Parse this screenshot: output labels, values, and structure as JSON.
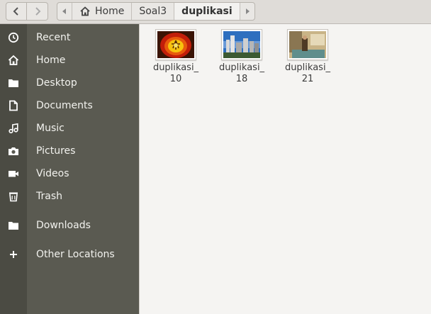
{
  "nav": {
    "back_icon": "chevron-left",
    "forward_icon": "chevron-right"
  },
  "pathbar": {
    "segments": [
      {
        "label": "Home",
        "icon": "home-icon"
      },
      {
        "label": "Soal3"
      },
      {
        "label": "duplikasi",
        "current": true
      }
    ]
  },
  "sidebar": {
    "items": [
      {
        "label": "Recent",
        "icon": "clock-icon"
      },
      {
        "label": "Home",
        "icon": "home-icon"
      },
      {
        "label": "Desktop",
        "icon": "folder-icon"
      },
      {
        "label": "Documents",
        "icon": "document-icon"
      },
      {
        "label": "Music",
        "icon": "music-icon"
      },
      {
        "label": "Pictures",
        "icon": "camera-icon"
      },
      {
        "label": "Videos",
        "icon": "video-icon"
      },
      {
        "label": "Trash",
        "icon": "trash-icon"
      },
      {
        "label": "Downloads",
        "icon": "folder-icon"
      },
      {
        "label": "Other Locations",
        "icon": "plus-icon"
      }
    ]
  },
  "files": [
    {
      "line1": "duplikasi_",
      "line2": "10",
      "thumb": "tulip-image"
    },
    {
      "line1": "duplikasi_",
      "line2": "18",
      "thumb": "city-skyline-image"
    },
    {
      "line1": "duplikasi_",
      "line2": "21",
      "thumb": "room-image"
    }
  ]
}
